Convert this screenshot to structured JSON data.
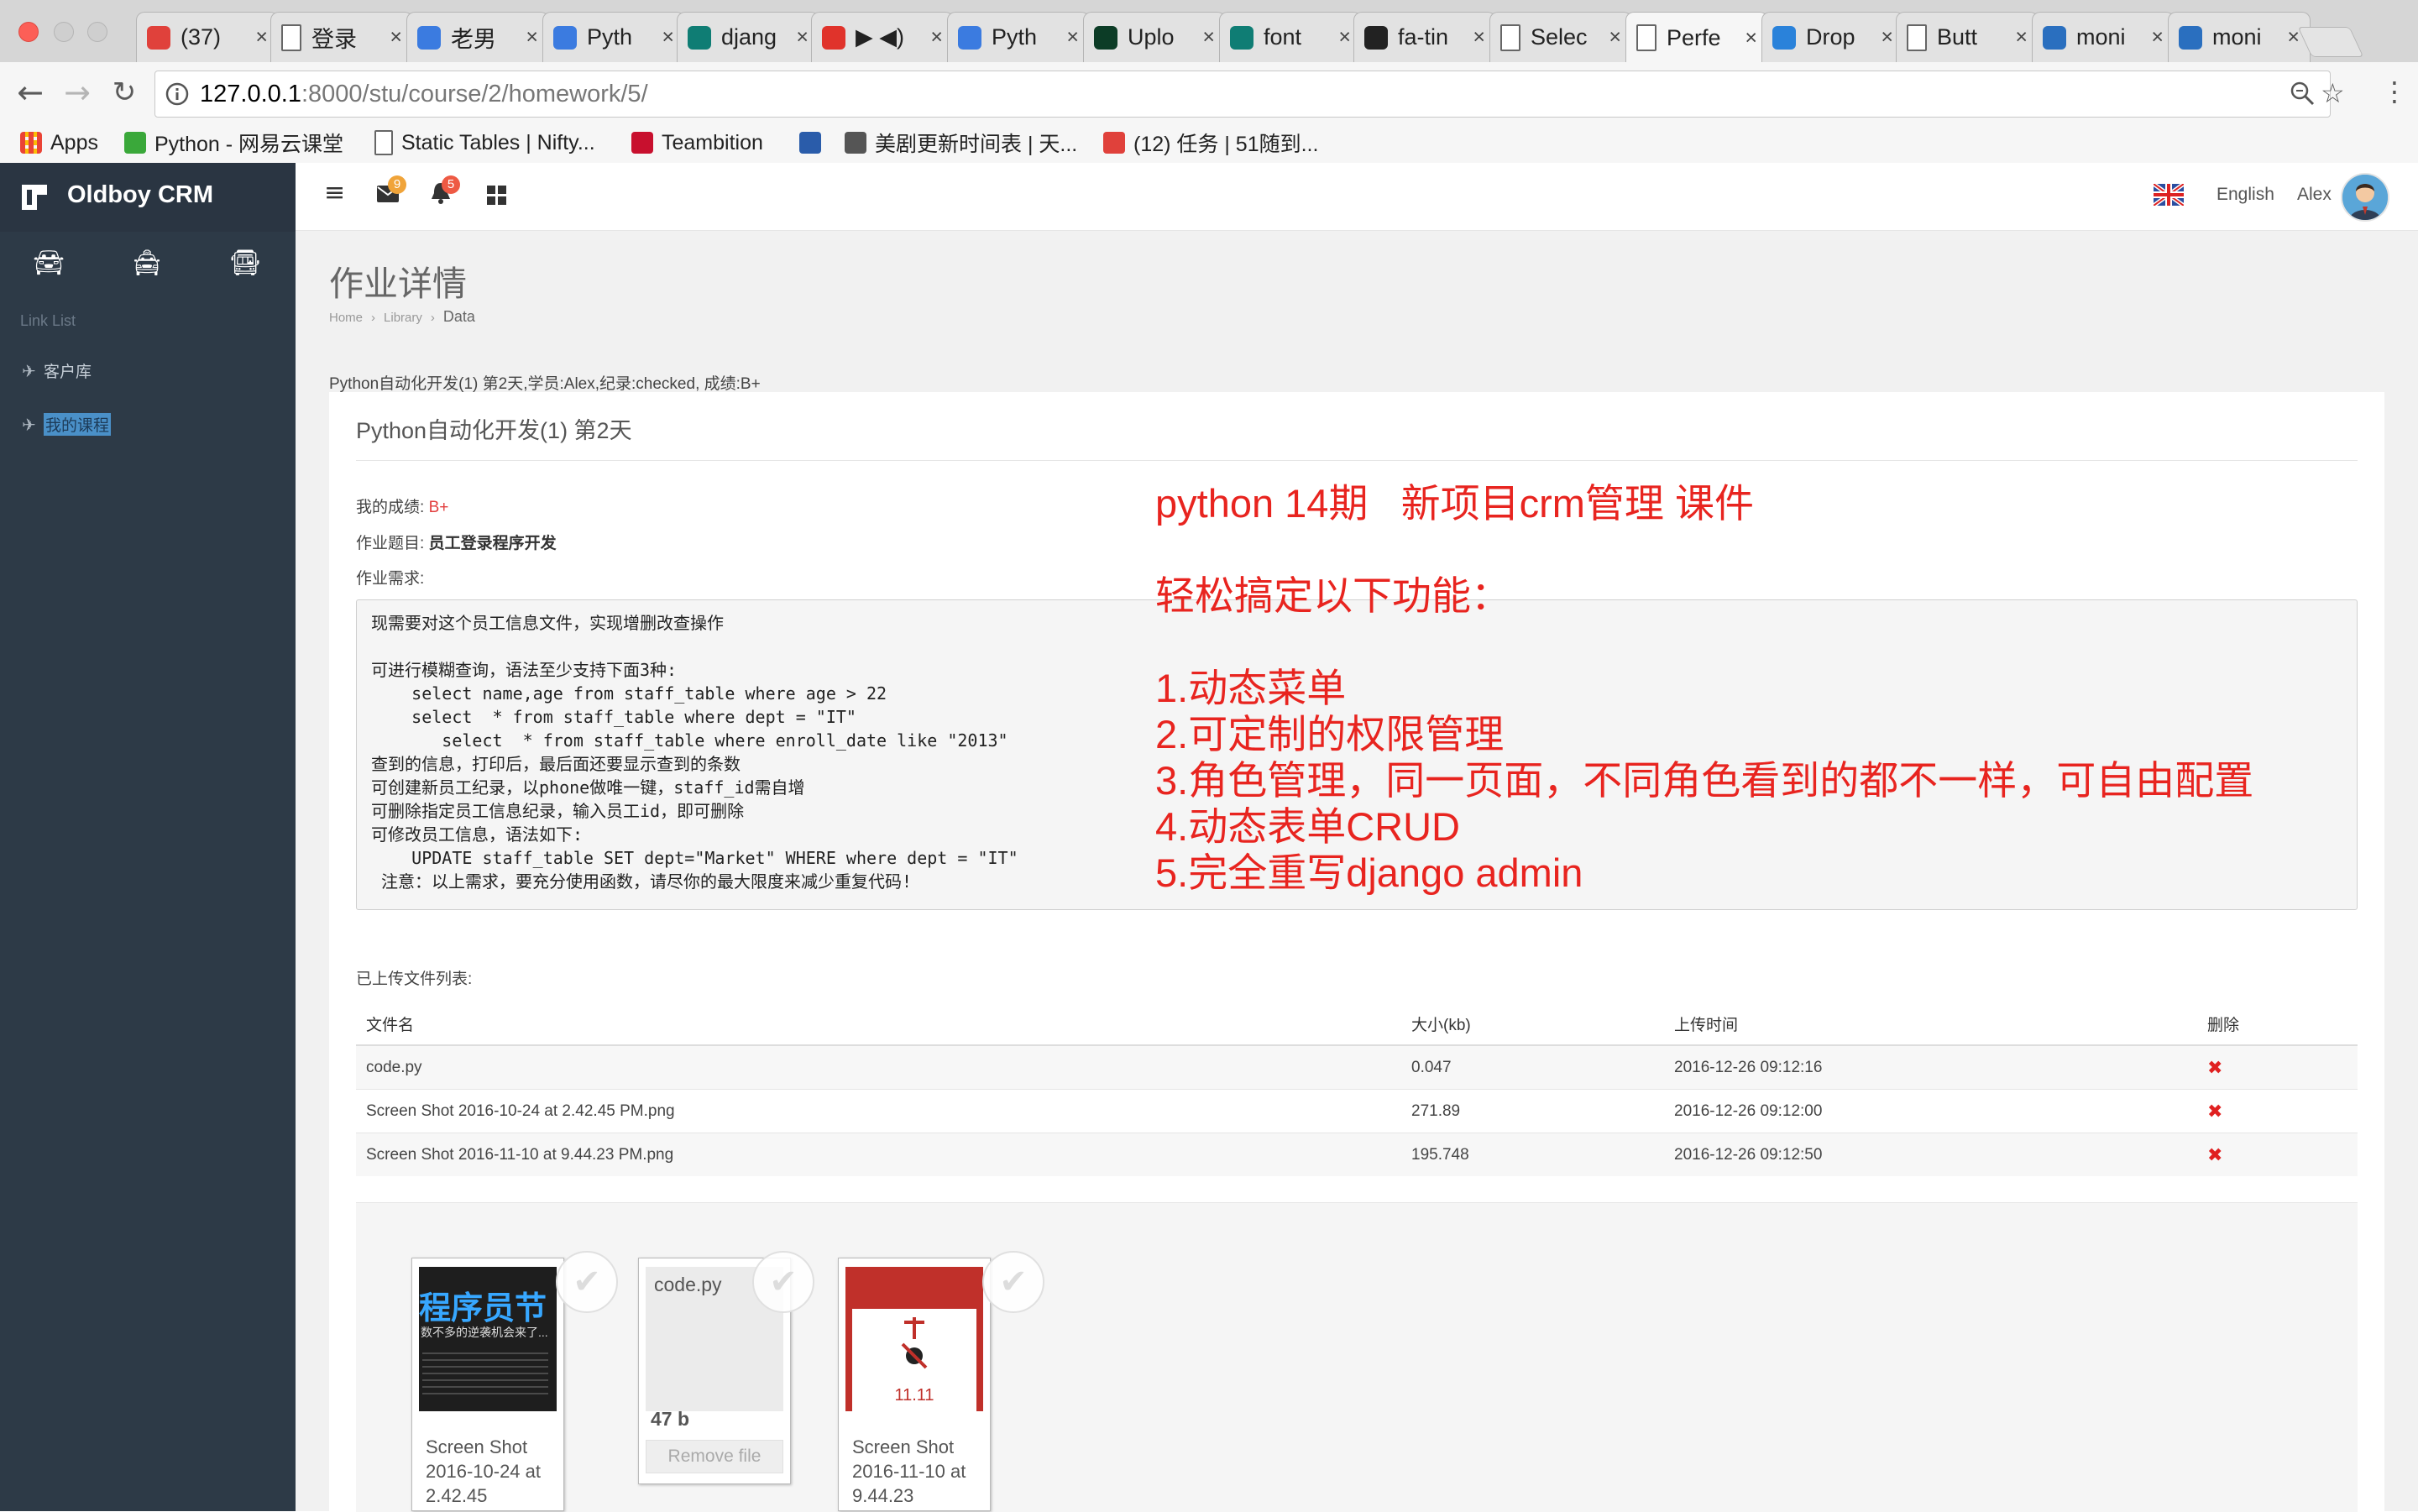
{
  "browser": {
    "tabs": [
      {
        "title": "(37)",
        "icon": "red-calendar-icon",
        "color": "#e0413b"
      },
      {
        "title": "登录",
        "icon": "page-icon",
        "color": "#ffffff"
      },
      {
        "title": "老男",
        "icon": "blue-flower-icon",
        "color": "#3b7be0"
      },
      {
        "title": "Pyth",
        "icon": "blue-flower-icon",
        "color": "#3b7be0"
      },
      {
        "title": "djang",
        "icon": "bing-icon",
        "color": "#0f7d74"
      },
      {
        "title": "▶ ◀)",
        "icon": "netease-music-icon",
        "color": "#e0332b"
      },
      {
        "title": "Pyth",
        "icon": "blue-flower-icon",
        "color": "#3b7be0"
      },
      {
        "title": "Uplo",
        "icon": "django-icon",
        "color": "#0c3c26"
      },
      {
        "title": "font",
        "icon": "bing-icon",
        "color": "#0f7d74"
      },
      {
        "title": "fa-tin",
        "icon": "font-awesome-icon",
        "color": "#222222"
      },
      {
        "title": "Selec",
        "icon": "page-icon",
        "color": "#ffffff"
      },
      {
        "title": "Perfe",
        "icon": "page-icon",
        "color": "#ffffff",
        "active": true
      },
      {
        "title": "Drop",
        "icon": "dropzone-icon",
        "color": "#2a82da"
      },
      {
        "title": "Butt",
        "icon": "page-icon",
        "color": "#ffffff"
      },
      {
        "title": "moni",
        "icon": "on-icon",
        "color": "#2a6fbf"
      },
      {
        "title": "moni",
        "icon": "on-icon",
        "color": "#2a6fbf"
      }
    ],
    "url_host": "127.0.0.1",
    "url_path": ":8000/stu/course/2/homework/5/",
    "bookmarks": [
      {
        "label": "Apps",
        "icon": "apps-grid-icon"
      },
      {
        "label": "Python - 网易云课堂",
        "icon": "netease-study-icon"
      },
      {
        "label": "Static Tables | Nifty...",
        "icon": "page-icon"
      },
      {
        "label": "Teambition",
        "icon": "teambition-icon"
      },
      {
        "label": "",
        "icon": "butterfly-icon"
      },
      {
        "label": "美剧更新时间表 | 天...",
        "icon": "tv-icon"
      },
      {
        "label": "(12) 任务 | 51随到...",
        "icon": "red-calendar-icon"
      }
    ]
  },
  "app": {
    "brand": "Oldboy CRM",
    "sidebar": {
      "section_label": "Link List",
      "items": [
        {
          "label": "客户库",
          "icon": "plane-icon",
          "active": false
        },
        {
          "label": "我的课程",
          "icon": "plane-icon",
          "active": true
        }
      ]
    },
    "topnav": {
      "mail_count": "9",
      "bell_count": "5",
      "language": "English",
      "user": "Alex"
    },
    "page_title": "作业详情",
    "breadcrumb": [
      "Home",
      "Library",
      "Data"
    ],
    "homework_meta": "Python自动化开发(1) 第2天,学员:Alex,纪录:checked, 成绩:B+",
    "panel_title": "Python自动化开发(1) 第2天",
    "grade_label": "我的成绩: ",
    "grade_value": "B+",
    "topic_label": "作业题目: ",
    "topic_value": "员工登录程序开发",
    "requirement_label": "作业需求:",
    "requirement_text": "现需要对这个员工信息文件，实现增删改查操作\n\n可进行模糊查询，语法至少支持下面3种:\n    select name,age from staff_table where age > 22\n    select  * from staff_table where dept = \"IT\"\n       select  * from staff_table where enroll_date like \"2013\"\n查到的信息，打印后，最后面还要显示查到的条数\n可创建新员工纪录，以phone做唯一键，staff_id需自增\n可删除指定员工信息纪录，输入员工id，即可删除\n可修改员工信息，语法如下:\n    UPDATE staff_table SET dept=\"Market\" WHERE where dept = \"IT\"\n 注意：以上需求，要充分使用函数，请尽你的最大限度来减少重复代码!",
    "overlay_text": "python 14期   新项目crm管理 课件\n\n轻松搞定以下功能：\n\n1.动态菜单\n2.可定制的权限管理\n3.角色管理，同一页面，不同角色看到的都不一样，可自由配置\n4.动态表单CRUD\n5.完全重写django admin",
    "files_label": "已上传文件列表:",
    "file_table": {
      "headers": [
        "文件名",
        "大小(kb)",
        "上传时间",
        "删除"
      ],
      "rows": [
        {
          "name": "code.py",
          "size": "0.047",
          "time": "2016-12-26 09:12:16"
        },
        {
          "name": "Screen Shot 2016-10-24 at 2.42.45 PM.png",
          "size": "271.89",
          "time": "2016-12-26 09:12:00"
        },
        {
          "name": "Screen Shot 2016-11-10 at 9.44.23 PM.png",
          "size": "195.748",
          "time": "2016-12-26 09:12:50"
        }
      ]
    },
    "dropzone": [
      {
        "name": "Screen Shot\n2016-10-24 at\n2.42.45",
        "thumb_text": "程序员节",
        "thumb_sub": "数不多的逆袭机会来了..."
      },
      {
        "name": "code.py",
        "size": "47 b",
        "remove": "Remove file"
      },
      {
        "name": "Screen Shot\n2016-11-10 at\n9.44.23",
        "thumb_text": "11.11"
      }
    ]
  },
  "colors": {
    "sidebar": "#2d3a47",
    "content_bg": "#f1f1f1",
    "overlay_red": "#e8241f",
    "grade_red": "#e23d3d",
    "mail_badge": "#f0a43a",
    "bell_badge": "#ee5a44"
  }
}
